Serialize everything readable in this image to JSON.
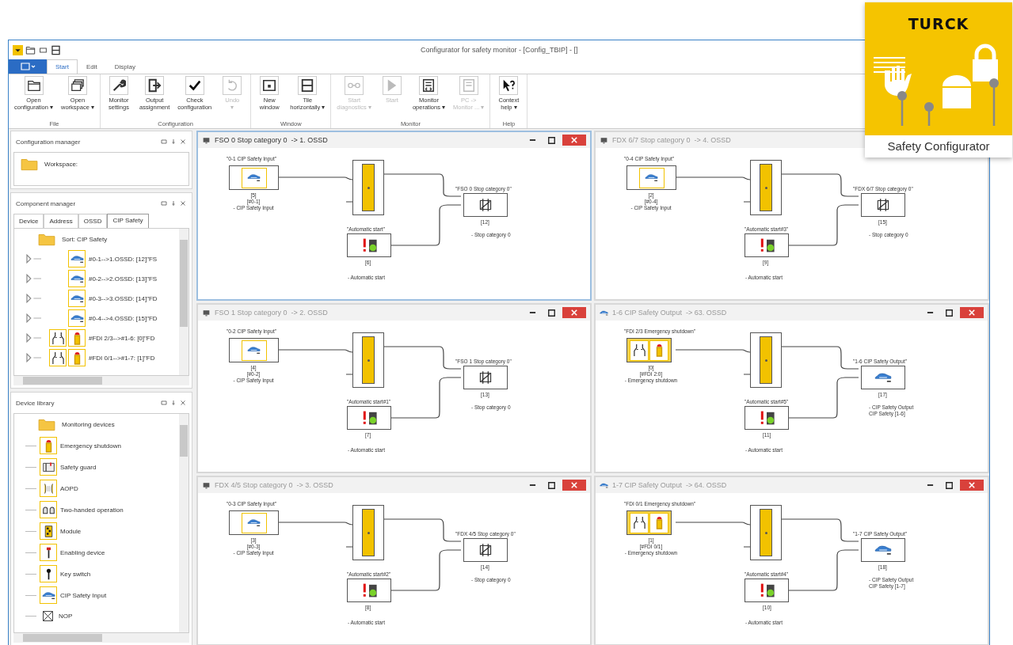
{
  "app": {
    "title": "Configurator for safety monitor - [Config_TBIP] - []"
  },
  "tabs": [
    {
      "label": "Start",
      "selected": true
    },
    {
      "label": "Edit",
      "selected": false
    },
    {
      "label": "Display",
      "selected": false
    }
  ],
  "ribbon": [
    {
      "label": "File",
      "buttons": [
        {
          "kind": "folder-open",
          "lines": [
            "Open",
            "configuration ▾"
          ],
          "disabled": false
        },
        {
          "kind": "windows",
          "lines": [
            "Open",
            "workspace ▾"
          ],
          "disabled": false
        }
      ]
    },
    {
      "label": "Configuration",
      "buttons": [
        {
          "kind": "wrench",
          "lines": [
            "Monitor",
            "settings"
          ],
          "disabled": false
        },
        {
          "kind": "export",
          "lines": [
            "Output",
            "assignment"
          ],
          "disabled": false
        },
        {
          "kind": "check",
          "lines": [
            "Check",
            "configuration"
          ],
          "disabled": false
        },
        {
          "kind": "undo",
          "lines": [
            "Undo",
            "▾"
          ],
          "disabled": true
        }
      ]
    },
    {
      "label": "Window",
      "buttons": [
        {
          "kind": "window-dot",
          "lines": [
            "New",
            "window"
          ],
          "disabled": false
        },
        {
          "kind": "tile",
          "lines": [
            "Tile",
            "horizontally ▾"
          ],
          "disabled": false
        }
      ]
    },
    {
      "label": "Monitor",
      "buttons": [
        {
          "kind": "glasses",
          "lines": [
            "Start",
            "diagnostics ▾"
          ],
          "disabled": true
        },
        {
          "kind": "play",
          "lines": [
            "Start"
          ],
          "disabled": true
        },
        {
          "kind": "monitor-ops",
          "lines": [
            "Monitor",
            "operations ▾"
          ],
          "disabled": false
        },
        {
          "kind": "pc-monitor",
          "lines": [
            "PC ->",
            "Monitor ... ▾"
          ],
          "disabled": true
        }
      ]
    },
    {
      "label": "Help",
      "buttons": [
        {
          "kind": "help-cursor",
          "lines": [
            "Context",
            "help ▾"
          ],
          "disabled": false
        }
      ]
    }
  ],
  "configuration_manager": {
    "title": "Configuration manager",
    "root": "Workspace:"
  },
  "component_manager": {
    "title": "Component manager",
    "tabs": [
      {
        "label": "Device",
        "selected": false
      },
      {
        "label": "Address",
        "selected": false
      },
      {
        "label": "OSSD",
        "selected": false
      },
      {
        "label": "CIP Safety",
        "selected": true
      }
    ],
    "root": "Sort: CIP Safety",
    "items": [
      {
        "kind": "cip",
        "label": "#0-1-->1.OSSD: [12]\"FS"
      },
      {
        "kind": "cip",
        "label": "#0-2-->2.OSSD: [13]\"FS"
      },
      {
        "kind": "cip",
        "label": "#0-3-->3.OSSD: [14]\"FD"
      },
      {
        "kind": "cip",
        "label": "#0-4-->4.OSSD: [15]\"FD"
      },
      {
        "kind": "emergency",
        "label": "#FDI 2/3-->#1-6: [0]\"FD"
      },
      {
        "kind": "emergency",
        "label": "#FDI 0/1-->#1-7: [1]\"FD"
      }
    ]
  },
  "device_library": {
    "title": "Device library",
    "root": "Monitoring devices",
    "items": [
      {
        "kind": "estop",
        "label": "Emergency shutdown"
      },
      {
        "kind": "guard",
        "label": "Safety guard"
      },
      {
        "kind": "aopd",
        "label": "AOPD"
      },
      {
        "kind": "twohand",
        "label": "Two-handed operation"
      },
      {
        "kind": "module",
        "label": "Module"
      },
      {
        "kind": "enabling",
        "label": "Enabling device"
      },
      {
        "kind": "key",
        "label": "Key switch"
      },
      {
        "kind": "car",
        "label": "CIP Safety Input"
      },
      {
        "kind": "nop",
        "label": "NOP"
      }
    ]
  },
  "windows": [
    {
      "title": "FSO 0 Stop category 0  -> 1. OSSD",
      "kind": "stop",
      "active": true,
      "buttons": [
        {
          "kind": "minimize"
        },
        {
          "kind": "maximize"
        },
        {
          "kind": "close"
        }
      ],
      "source": {
        "kind": "cip",
        "label": "\"0-1 CIP Safety Input\"",
        "lines": [
          "[5]",
          "[#0-1]",
          "- CIP Safety Input"
        ]
      },
      "start": {
        "label": "\"Automatic start\"",
        "id": "[6]",
        "description": "- Automatic start"
      },
      "output": {
        "kind": "stop",
        "label": "\"FSO 0 Stop category 0\"",
        "id": "[12]",
        "lines": [
          "- Stop category 0"
        ]
      }
    },
    {
      "title": "FDX 6/7 Stop category 0  -> 4. OSSD",
      "kind": "stop",
      "active": false,
      "source": {
        "kind": "cip",
        "label": "\"0-4 CIP Safety Input\"",
        "lines": [
          "[2]",
          "[#0-4]",
          "- CIP Safety Input"
        ]
      },
      "start": {
        "label": "\"Automatic start#3\"",
        "id": "[9]",
        "description": "- Automatic start"
      },
      "output": {
        "kind": "stop",
        "label": "\"FDX 6/7 Stop category 0\"",
        "id": "[15]",
        "lines": [
          "- Stop category 0"
        ]
      }
    },
    {
      "title": "FSO 1 Stop category 0  -> 2. OSSD",
      "kind": "stop",
      "active": false,
      "buttons": [
        {
          "kind": "minimize"
        },
        {
          "kind": "maximize"
        },
        {
          "kind": "close"
        }
      ],
      "source": {
        "kind": "cip",
        "label": "\"0-2 CIP Safety Input\"",
        "lines": [
          "[4]",
          "[#0-2]",
          "- CIP Safety Input"
        ]
      },
      "start": {
        "label": "\"Automatic start#1\"",
        "id": "[7]",
        "description": "- Automatic start"
      },
      "output": {
        "kind": "stop",
        "label": "\"FSO 1 Stop category 0\"",
        "id": "[13]",
        "lines": [
          "- Stop category 0"
        ]
      }
    },
    {
      "title": "1-6 CIP Safety Output  -> 63. OSSD",
      "kind": "output",
      "active": false,
      "buttons": [
        {
          "kind": "minimize"
        },
        {
          "kind": "maximize"
        },
        {
          "kind": "close"
        }
      ],
      "source": {
        "kind": "emergency",
        "label": "\"FDI 2/3 Emergency shutdown\"",
        "lines": [
          "[0]",
          "[#FDI 2:0]",
          "- Emergency shutdown"
        ]
      },
      "start": {
        "label": "\"Automatic start#5\"",
        "id": "[11]",
        "description": "- Automatic start"
      },
      "output": {
        "kind": "cip",
        "label": "\"1-6 CIP Safety Output\"",
        "id": "[17]",
        "lines": [
          "- CIP Safety Output",
          "CIP Safety [1-6]"
        ]
      }
    },
    {
      "title": "FDX 4/5 Stop category 0  -> 3. OSSD",
      "kind": "stop",
      "active": false,
      "buttons": [
        {
          "kind": "minimize"
        },
        {
          "kind": "maximize"
        },
        {
          "kind": "close"
        }
      ],
      "source": {
        "kind": "cip",
        "label": "\"0-3 CIP Safety Input\"",
        "lines": [
          "[3]",
          "[#0-3]",
          "- CIP Safety Input"
        ]
      },
      "start": {
        "label": "\"Automatic start#2\"",
        "id": "[8]",
        "description": "- Automatic start"
      },
      "output": {
        "kind": "stop",
        "label": "\"FDX 4/5 Stop category 0\"",
        "id": "[14]",
        "lines": [
          "- Stop category 0"
        ]
      }
    },
    {
      "title": "1-7 CIP Safety Output  -> 64. OSSD",
      "kind": "output",
      "active": false,
      "buttons": [
        {
          "kind": "minimize"
        },
        {
          "kind": "maximize"
        },
        {
          "kind": "close"
        }
      ],
      "source": {
        "kind": "emergency",
        "label": "\"FDI 0/1 Emergency shutdown\"",
        "lines": [
          "[1]",
          "[#FDI 0/1]",
          "- Emergency shutdown"
        ]
      },
      "start": {
        "label": "\"Automatic start#4\"",
        "id": "[10]",
        "description": "- Automatic start"
      },
      "output": {
        "kind": "cip",
        "label": "\"1-7 CIP Safety Output\"",
        "id": "[18]",
        "lines": [
          "- CIP Safety Output",
          "CIP Safety [1-7]"
        ]
      }
    }
  ],
  "logo": {
    "brand": "TURCK",
    "caption": "Safety Configurator"
  }
}
